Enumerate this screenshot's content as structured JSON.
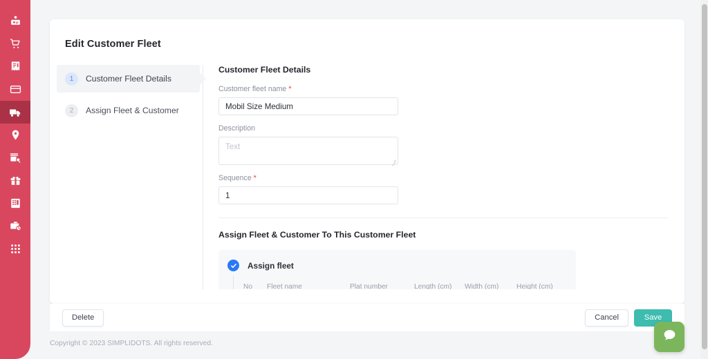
{
  "sidebar": {
    "bg_color": "#d9475e",
    "active_bg_color": "#ab3246",
    "items": [
      {
        "icon": "user-card-icon",
        "name": "sidebar-item-customer",
        "active": false
      },
      {
        "icon": "shopping-cart-icon",
        "name": "sidebar-item-orders",
        "active": false
      },
      {
        "icon": "receipt-icon",
        "name": "sidebar-item-invoices",
        "active": false
      },
      {
        "icon": "credit-card-icon",
        "name": "sidebar-item-payments",
        "active": false
      },
      {
        "icon": "delivery-truck-icon",
        "name": "sidebar-item-delivery",
        "active": true
      },
      {
        "icon": "map-pin-icon",
        "name": "sidebar-item-location",
        "active": false
      },
      {
        "icon": "store-search-icon",
        "name": "sidebar-item-store-survey",
        "active": false
      },
      {
        "icon": "gift-icon",
        "name": "sidebar-item-promo",
        "active": false
      },
      {
        "icon": "report-table-icon",
        "name": "sidebar-item-reports",
        "active": false
      },
      {
        "icon": "briefcase-clock-icon",
        "name": "sidebar-item-attendance",
        "active": false
      },
      {
        "icon": "grid-apps-icon",
        "name": "sidebar-item-apps",
        "active": false
      }
    ]
  },
  "card": {
    "title": "Edit Customer Fleet"
  },
  "steps": [
    {
      "number": "1",
      "label": "Customer Fleet Details",
      "active": true
    },
    {
      "number": "2",
      "label": "Assign Fleet & Customer",
      "active": false
    }
  ],
  "form": {
    "section_title": "Customer Fleet Details",
    "fields": {
      "fleet_name": {
        "label": "Customer fleet name",
        "required": true,
        "value": "Mobil Size Medium",
        "placeholder": ""
      },
      "description": {
        "label": "Description",
        "required": false,
        "value": "",
        "placeholder": "Text"
      },
      "sequence": {
        "label": "Sequence",
        "required": true,
        "value": "1",
        "placeholder": ""
      }
    },
    "required_marker": "*"
  },
  "assign": {
    "section_title": "Assign Fleet & Customer To This Customer Fleet",
    "checkbox_label": "Assign fleet",
    "checkbox_checked": true,
    "check_color": "#2979f7",
    "table": {
      "columns": [
        "No",
        "Fleet name",
        "Plat number",
        "Length (cm)",
        "Width (cm)",
        "Height (cm)"
      ],
      "rows": []
    }
  },
  "actions": {
    "delete_label": "Delete",
    "cancel_label": "Cancel",
    "save_label": "Save",
    "save_color": "#3dbcaf"
  },
  "footer": {
    "copyright": "Copyright © 2023 SIMPLIDOTS. All rights reserved."
  },
  "chat": {
    "icon": "chat-bubble-icon",
    "color": "#7cb65c"
  }
}
